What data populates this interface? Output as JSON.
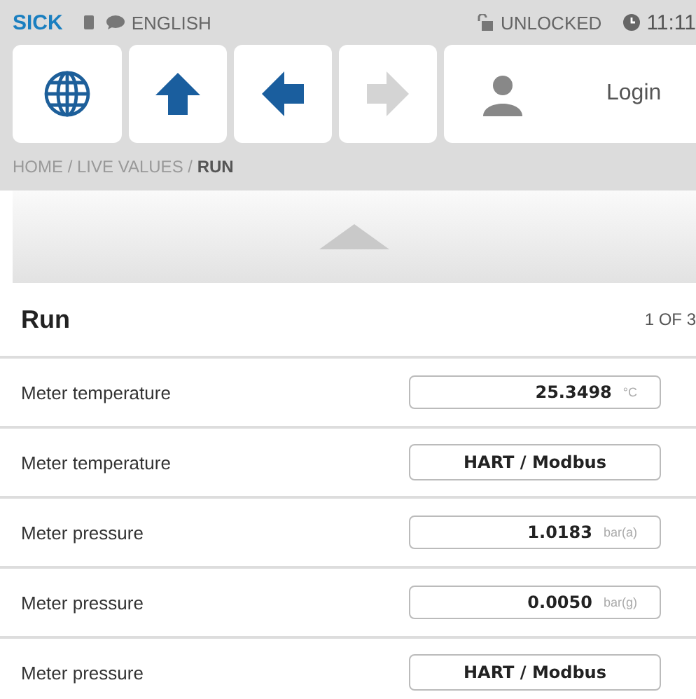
{
  "status_bar": {
    "brand": "SICK",
    "language": "ENGLISH",
    "lock_state": "UNLOCKED",
    "time": "11:11"
  },
  "toolbar": [
    {
      "kind": "globe",
      "disabled": false
    },
    {
      "kind": "up",
      "disabled": false
    },
    {
      "kind": "back",
      "disabled": false
    },
    {
      "kind": "forward",
      "disabled": true
    }
  ],
  "login": {
    "label": "Login"
  },
  "breadcrumb": "HOME / LIVE VALUES / **RUN**",
  "section": {
    "title": "Run",
    "page": "1 OF 3"
  },
  "rows": [
    {
      "kind": "numeric",
      "label": "Meter temperature",
      "value": "25.3498",
      "unit": "°C"
    },
    {
      "kind": "text",
      "label": "Meter temperature",
      "value": "HART / Modbus"
    },
    {
      "kind": "numeric",
      "label": "Meter pressure",
      "value": "1.0183",
      "unit": "bar(a)"
    },
    {
      "kind": "numeric",
      "label": "Meter pressure",
      "value": "0.0050",
      "unit": "bar(g)"
    },
    {
      "kind": "text",
      "label": "Meter pressure",
      "value": "HART / Modbus"
    }
  ]
}
